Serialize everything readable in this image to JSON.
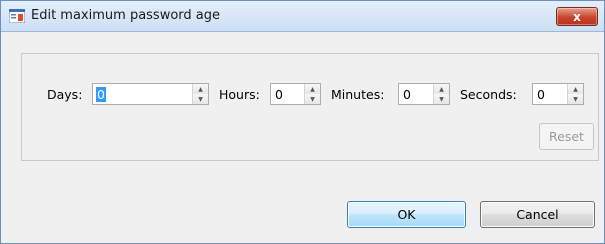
{
  "window": {
    "title": "Edit maximum password age",
    "close_label": "x"
  },
  "fields": {
    "days": {
      "label": "Days:",
      "value": "0"
    },
    "hours": {
      "label": "Hours:",
      "value": "0"
    },
    "minutes": {
      "label": "Minutes:",
      "value": "0"
    },
    "seconds": {
      "label": "Seconds:",
      "value": "0"
    }
  },
  "buttons": {
    "reset": "Reset",
    "ok": "OK",
    "cancel": "Cancel"
  },
  "icons": {
    "app": "dialog-window-icon",
    "close": "close-icon",
    "spin_up": "chevron-up-icon",
    "spin_down": "chevron-down-icon"
  },
  "colors": {
    "selection": "#3399ff",
    "close_button": "#c8452d",
    "ok_border": "#3c7fb1"
  }
}
